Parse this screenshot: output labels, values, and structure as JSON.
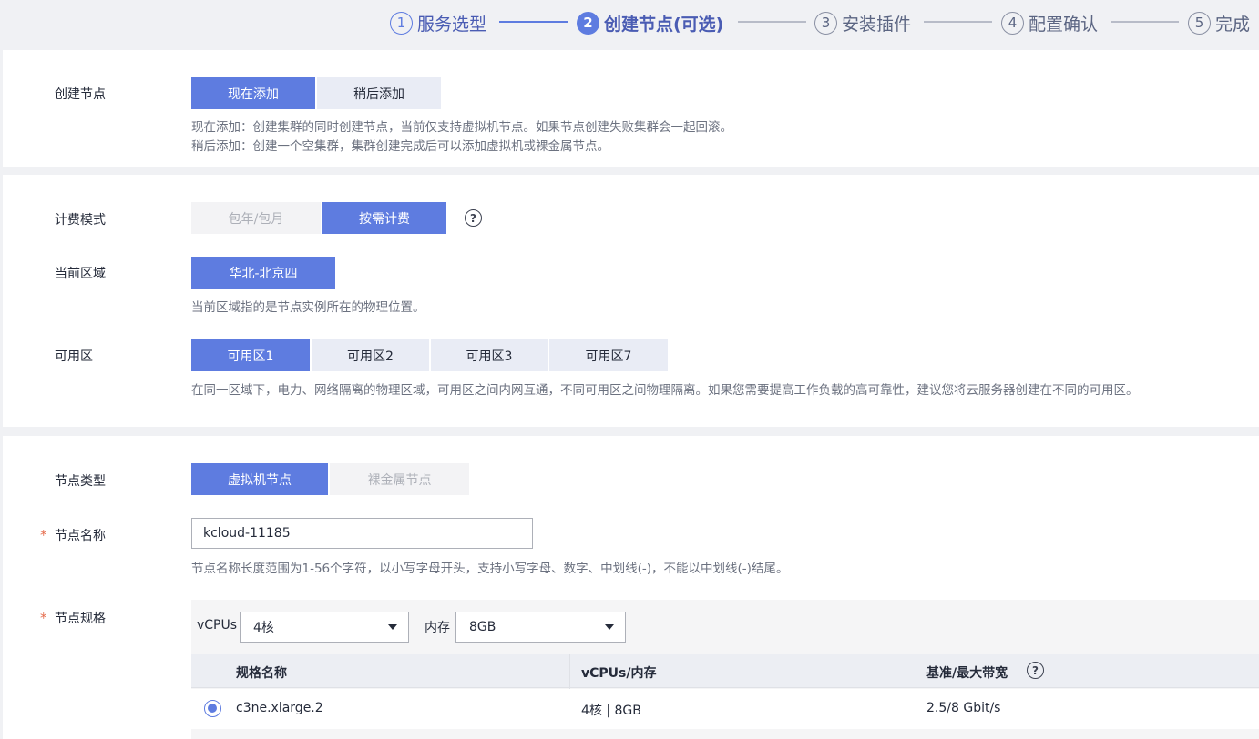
{
  "stepper": {
    "steps": [
      {
        "num": "1",
        "label": "服务选型"
      },
      {
        "num": "2",
        "label": "创建节点(可选)"
      },
      {
        "num": "3",
        "label": "安装插件"
      },
      {
        "num": "4",
        "label": "配置确认"
      },
      {
        "num": "5",
        "label": "完成"
      }
    ]
  },
  "create_node": {
    "label": "创建节点",
    "options": [
      "现在添加",
      "稍后添加"
    ],
    "selected": "现在添加",
    "hint1": "现在添加：创建集群的同时创建节点，当前仅支持虚拟机节点。如果节点创建失败集群会一起回滚。",
    "hint2": "稍后添加：创建一个空集群，集群创建完成后可以添加虚拟机或裸金属节点。"
  },
  "billing": {
    "label": "计费模式",
    "options": [
      "包年/包月",
      "按需计费"
    ],
    "selected": "按需计费",
    "help": "?"
  },
  "region": {
    "label": "当前区域",
    "value": "华北-北京四",
    "hint": "当前区域指的是节点实例所在的物理位置。"
  },
  "az": {
    "label": "可用区",
    "options": [
      "可用区1",
      "可用区2",
      "可用区3",
      "可用区7"
    ],
    "selected": "可用区1",
    "hint": "在同一区域下，电力、网络隔离的物理区域，可用区之间内网互通，不同可用区之间物理隔离。如果您需要提高工作负载的高可靠性，建议您将云服务器创建在不同的可用区。"
  },
  "node_type": {
    "label": "节点类型",
    "options": [
      "虚拟机节点",
      "裸金属节点"
    ],
    "selected": "虚拟机节点"
  },
  "node_name": {
    "required": "*",
    "label": "节点名称",
    "value": "kcloud-11185",
    "hint": "节点名称长度范围为1-56个字符，以小写字母开头，支持小写字母、数字、中划线(-)，不能以中划线(-)结尾。"
  },
  "node_spec": {
    "required": "*",
    "label": "节点规格",
    "vcpu_label": "vCPUs",
    "vcpu_value": "4核",
    "mem_label": "内存",
    "mem_value": "8GB",
    "columns": [
      "规格名称",
      "vCPUs/内存",
      "基准/最大带宽"
    ],
    "help": "?",
    "rows": [
      {
        "name": "c3ne.xlarge.2",
        "vcpu_mem": "4核 | 8GB",
        "bandwidth": "2.5/8 Gbit/s"
      }
    ]
  },
  "colors": {
    "accent": "#5e7ce0",
    "required": "#e66e4f"
  }
}
